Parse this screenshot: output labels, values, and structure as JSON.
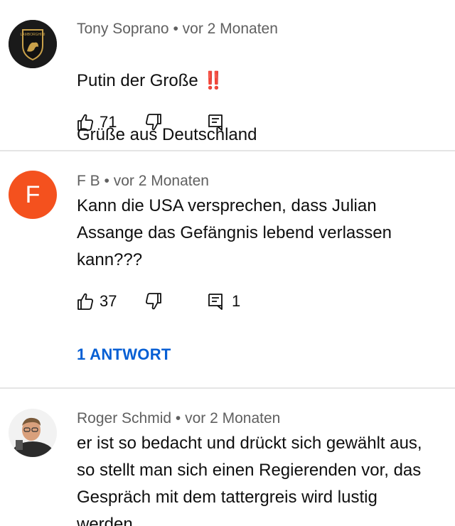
{
  "comments": [
    {
      "author": "Tony Soprano",
      "time": "vor 2 Monaten",
      "text_line1": "Putin  der Große",
      "emoji": "‼️",
      "text_line2": "Grüße aus Deutschland",
      "likes": "71",
      "replies_count": "",
      "avatar_icon": "lamborghini-logo-icon",
      "avatar_logo_text": "LAMBORGHINI"
    },
    {
      "author": "F B",
      "time": "vor 2 Monaten",
      "avatar_letter": "F",
      "avatar_color": "#f4511e",
      "text": "Kann die USA versprechen, dass Julian\nAssange das Gefängnis lebend verlassen\nkann???",
      "likes": "37",
      "replies_count": "1",
      "replies_label": "1 ANTWORT"
    },
    {
      "author": "Roger Schmid",
      "time": "vor 2 Monaten",
      "text": "er ist so bedacht und drückt sich gewählt aus,\nso stellt man sich einen Regierenden vor, das\nGespräch mit dem tattergreis wird lustig\nwerden",
      "avatar_icon": "person-photo-avatar"
    }
  ],
  "meta_separator": "•",
  "colors": {
    "accent": "#065fd4",
    "meta_text": "#606060",
    "divider": "#e5e5e5"
  }
}
